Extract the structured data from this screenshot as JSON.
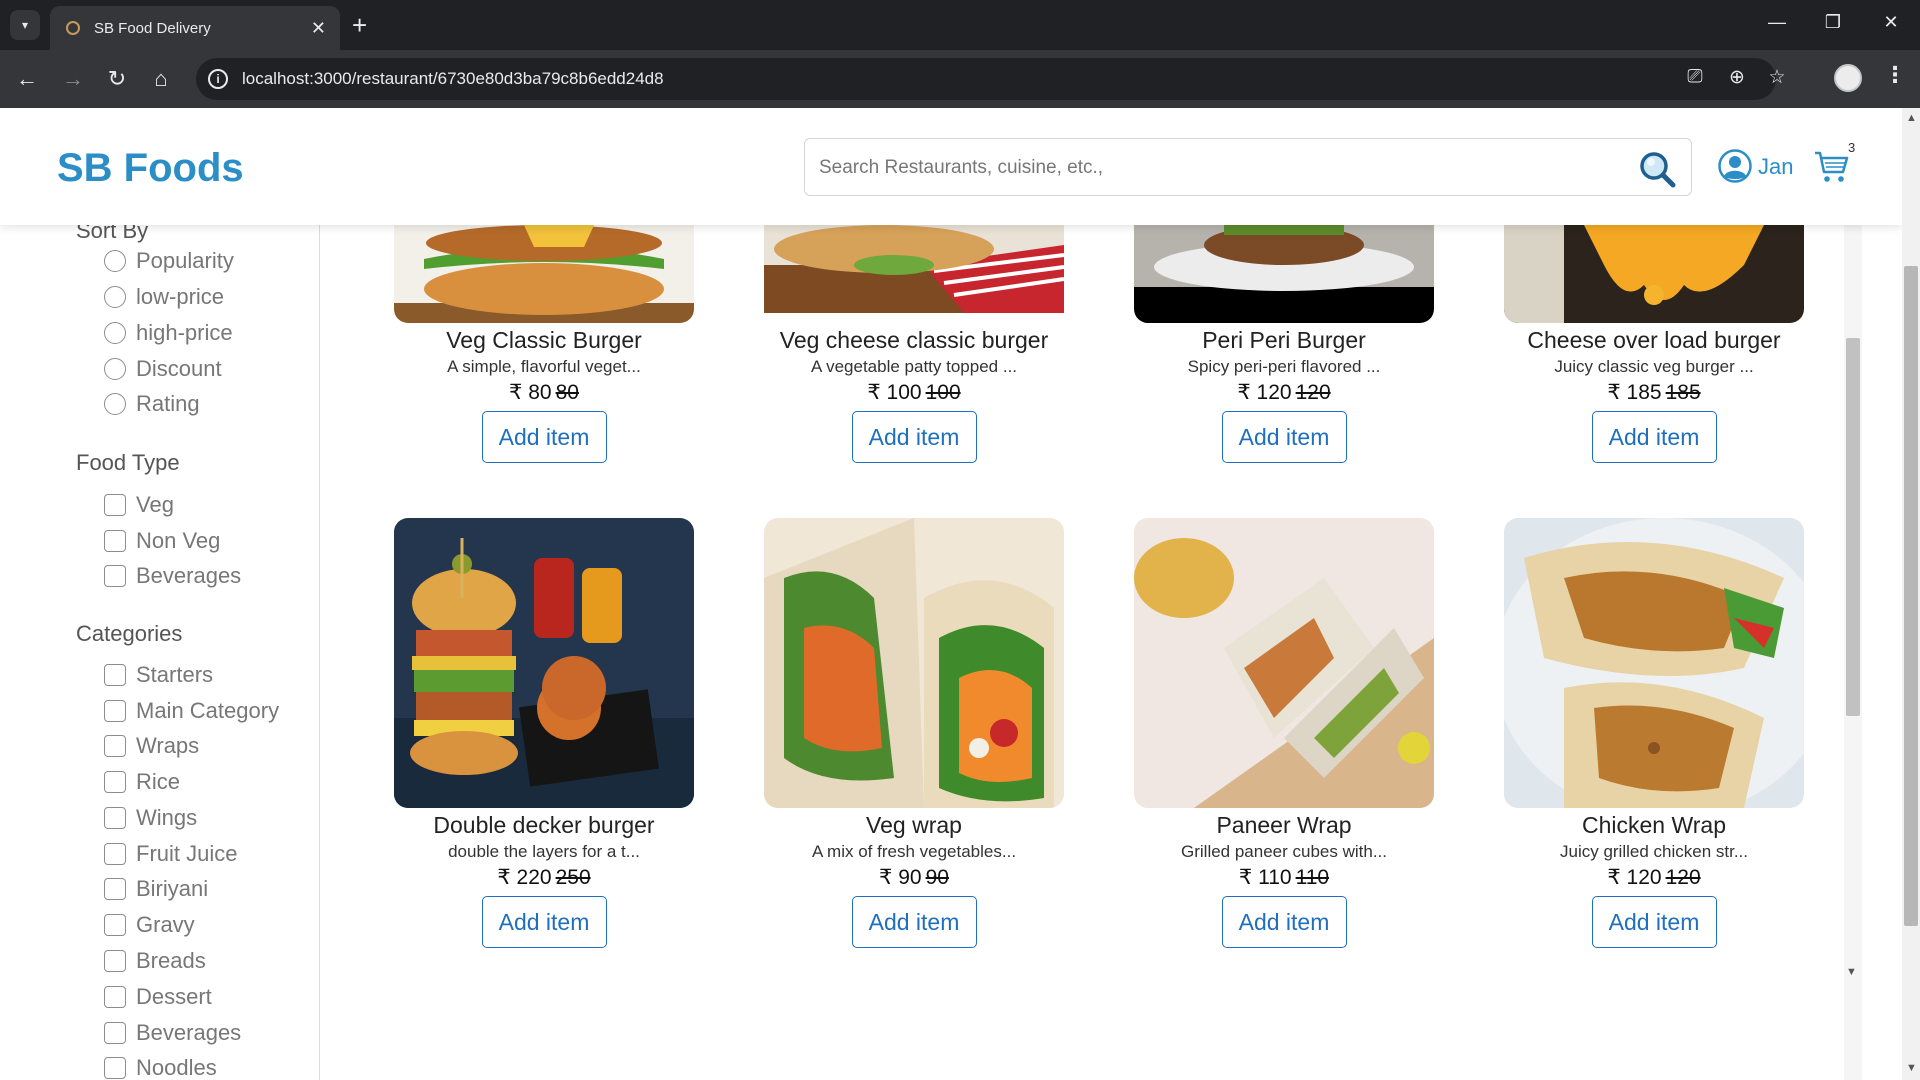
{
  "browser": {
    "tab_title": "SB Food Delivery",
    "url": "localhost:3000/restaurant/6730e80d3ba79c8b6edd24d8"
  },
  "header": {
    "brand": "SB Foods",
    "search_placeholder": "Search Restaurants, cuisine, etc.,",
    "user_name": "Jan",
    "cart_count": "3"
  },
  "sidebar": {
    "sort_title": "Sort By",
    "sort_options": [
      "Popularity",
      "low-price",
      "high-price",
      "Discount",
      "Rating"
    ],
    "food_type_title": "Food Type",
    "food_types": [
      "Veg",
      "Non Veg",
      "Beverages"
    ],
    "categories_title": "Categories",
    "categories": [
      "Starters",
      "Main Category",
      "Wraps",
      "Rice",
      "Wings",
      "Fruit Juice",
      "Biriyani",
      "Gravy",
      "Breads",
      "Dessert",
      "Beverages",
      "Noodles"
    ]
  },
  "products": [
    {
      "name": "Veg Classic Burger",
      "desc": "A simple, flavorful veget...",
      "price": "₹ 80",
      "old_price": "80",
      "button": "Add item"
    },
    {
      "name": "Veg cheese classic burger",
      "desc": "A vegetable patty topped ...",
      "price": "₹ 100",
      "old_price": "100",
      "button": "Add item"
    },
    {
      "name": "Peri Peri Burger",
      "desc": "Spicy peri-peri flavored ...",
      "price": "₹ 120",
      "old_price": "120",
      "button": "Add item"
    },
    {
      "name": "Cheese over load burger",
      "desc": "Juicy classic veg burger ...",
      "price": "₹ 185",
      "old_price": "185",
      "button": "Add item"
    },
    {
      "name": "Double decker burger",
      "desc": "double the layers for a t...",
      "price": "₹ 220",
      "old_price": "250",
      "button": "Add item"
    },
    {
      "name": "Veg wrap",
      "desc": "A mix of fresh vegetables...",
      "price": "₹ 90",
      "old_price": "90",
      "button": "Add item"
    },
    {
      "name": "Paneer Wrap",
      "desc": "Grilled paneer cubes with...",
      "price": "₹ 110",
      "old_price": "110",
      "button": "Add item"
    },
    {
      "name": "Chicken Wrap",
      "desc": "Juicy grilled chicken str...",
      "price": "₹ 120",
      "old_price": "120",
      "button": "Add item"
    }
  ],
  "colors": {
    "brand": "#2b8ec7",
    "button": "#1f6fbf",
    "chrome_dark": "#202124",
    "chrome_toolbar": "#35363a"
  }
}
